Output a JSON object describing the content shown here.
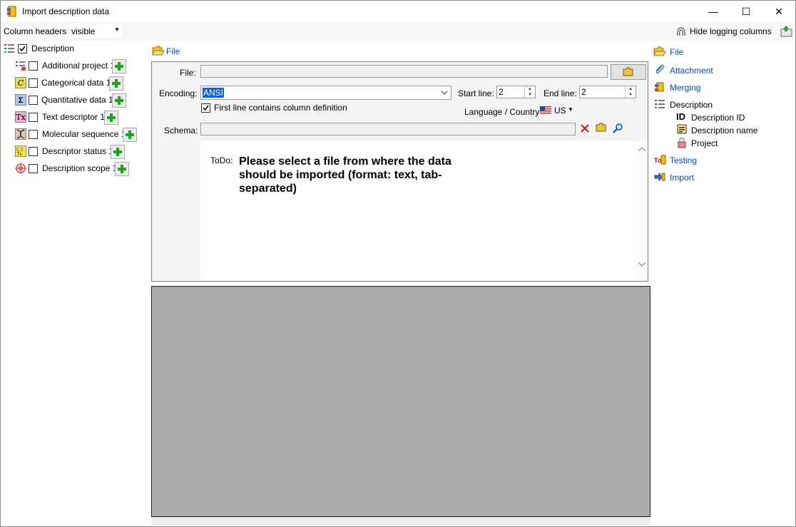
{
  "window": {
    "title": "Import description data",
    "minimize": "—",
    "maximize": "☐",
    "close": "✕"
  },
  "toolbar": {
    "column_headers_label": "Column headers",
    "column_headers_value": "visible",
    "hide_logging": "Hide logging columns"
  },
  "left_tree": {
    "root": "Description",
    "root_checked": true,
    "items": [
      {
        "label": "Additional project 1"
      },
      {
        "label": "Categorical data 1"
      },
      {
        "label": "Quantitative data 1"
      },
      {
        "label": "Text descriptor 1"
      },
      {
        "label": "Molecular sequence 1"
      },
      {
        "label": "Descriptor status 1"
      },
      {
        "label": "Description scope 1"
      }
    ]
  },
  "file_step": {
    "header": "File",
    "file_label": "File:",
    "file_value": "",
    "encoding_label": "Encoding:",
    "encoding_value": "ANSI",
    "start_line_label": "Start line:",
    "start_line_value": "2",
    "end_line_label": "End line:",
    "end_line_value": "2",
    "first_line_label": "First line contains column definition",
    "first_line_checked": true,
    "language_label": "Language / Country:",
    "language_value": "US",
    "schema_label": "Schema:",
    "schema_value": "",
    "todo_label": "ToDo:",
    "todo_text_1": "Please select a file from where the data",
    "todo_text_2": "should be imported (format: text, tab-",
    "todo_text_3": "separated)"
  },
  "right_nav": {
    "items": [
      {
        "label": "File"
      },
      {
        "label": "Attachment"
      },
      {
        "label": "Merging"
      }
    ],
    "description": "Description",
    "description_children": [
      {
        "label": "Description ID",
        "icon_text": "ID"
      },
      {
        "label": "Description name"
      },
      {
        "label": "Project"
      }
    ],
    "testing": "Testing",
    "import": "Import"
  }
}
